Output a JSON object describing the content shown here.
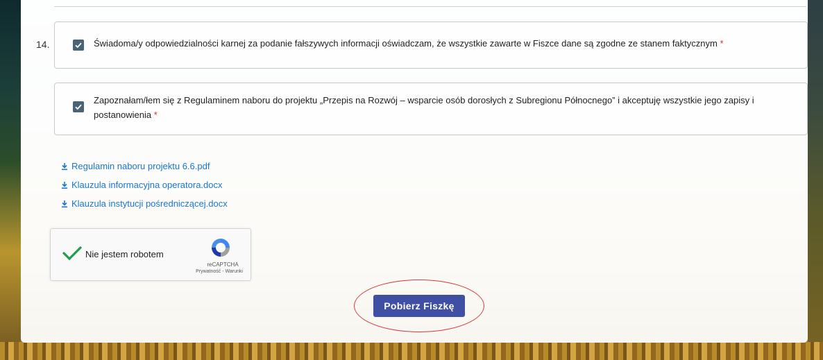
{
  "form": {
    "item_number": "14.",
    "checkbox1": {
      "text": "Świadoma/y odpowiedzialności karnej za podanie fałszywych informacji oświadczam, że wszystkie zawarte w Fiszce dane są zgodne ze stanem faktycznym",
      "required_mark": "*",
      "checked": true
    },
    "checkbox2": {
      "text_line1": "Zapoznałam/łem się z Regulaminem naboru do projektu „Przepis na Rozwój – wsparcie osób dorosłych z Subregionu Północnego” i akceptuję wszystkie jego zapisy i",
      "text_line2": "postanowienia",
      "required_mark": "*",
      "checked": true
    },
    "links": [
      {
        "label": "Regulamin naboru projektu 6.6.pdf",
        "icon": "download-icon"
      },
      {
        "label": "Klauzula informacyjna operatora.docx",
        "icon": "download-icon"
      },
      {
        "label": "Klauzula instytucji pośredniczącej.docx",
        "icon": "download-icon"
      }
    ],
    "captcha": {
      "label": "Nie jestem robotem",
      "brand": "reCAPTCHA",
      "terms": "Prywatność - Warunki",
      "checked": true
    },
    "submit_label": "Pobierz Fiszkę"
  },
  "colors": {
    "accent": "#3f4fa3",
    "link": "#1976d2",
    "required": "#d32f2f",
    "checkbox": "#4a6476",
    "highlight_ellipse": "#d23b3b"
  }
}
